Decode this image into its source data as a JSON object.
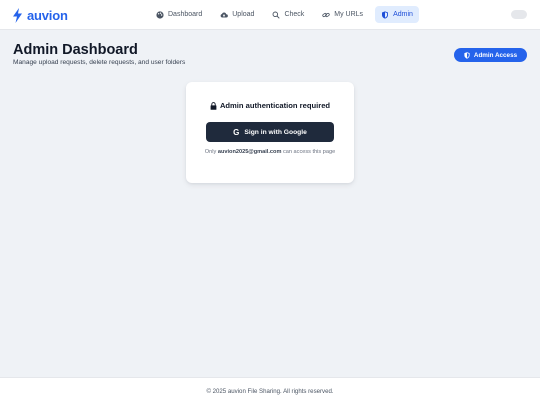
{
  "app": {
    "name": "auvion"
  },
  "nav": {
    "items": [
      {
        "label": "Dashboard",
        "icon": "palette-icon",
        "active": false
      },
      {
        "label": "Upload",
        "icon": "cloud-upload-icon",
        "active": false
      },
      {
        "label": "Check",
        "icon": "search-icon",
        "active": false
      },
      {
        "label": "My URLs",
        "icon": "link-icon",
        "active": false
      },
      {
        "label": "Admin",
        "icon": "shield-icon",
        "active": true
      }
    ]
  },
  "page": {
    "title": "Admin Dashboard",
    "subtitle": "Manage upload requests, delete requests, and user folders",
    "badge_label": "Admin Access"
  },
  "auth": {
    "title": "Admin authentication required",
    "button_label": "Sign in with Google",
    "note_prefix": "Only ",
    "note_email": "auvion2025@gmail.com",
    "note_suffix": " can access this page"
  },
  "footer": {
    "text": "© 2025 auvion File Sharing. All rights reserved."
  },
  "colors": {
    "brand": "#2563eb",
    "active_nav_bg": "#e0ecfe",
    "dark_button": "#1f2a3c",
    "page_bg": "#eff2f6"
  }
}
